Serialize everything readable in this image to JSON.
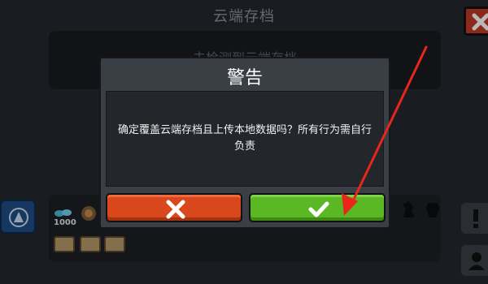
{
  "background": {
    "title": "云端存档",
    "panel_text": "未检测到云端存档",
    "coin_count": "1000",
    "close_icon": "close-icon",
    "settings_icon": "emblem-icon"
  },
  "dialog": {
    "title": "警告",
    "message": "确定覆盖云端存档且上传本地数据吗？所有行为需自行负责",
    "cancel_icon": "x-icon",
    "confirm_icon": "check-icon",
    "colors": {
      "cancel": "#d8481c",
      "confirm": "#5bb825"
    }
  },
  "annotation": {
    "arrow_color": "#e8261c"
  }
}
